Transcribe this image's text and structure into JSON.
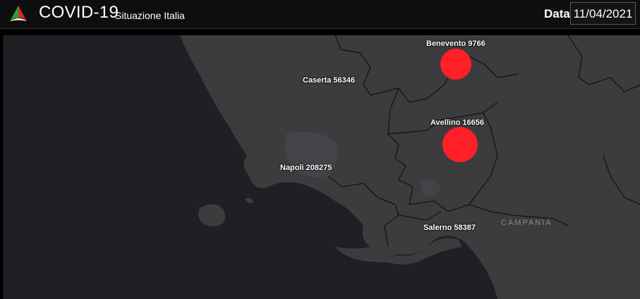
{
  "header": {
    "logo_icon": "italy-flag-cone-icon",
    "title": "COVID-19",
    "subtitle": "Situazione Italia",
    "date_label": "Data",
    "date_value": "11/04/2021"
  },
  "map": {
    "region_label": "CAMPANIA",
    "bubble_color": "#ff1f26",
    "provinces": [
      {
        "name": "Benevento",
        "cases": 9766,
        "label": "Benevento 9766"
      },
      {
        "name": "Caserta",
        "cases": 56346,
        "label": "Caserta 56346"
      },
      {
        "name": "Avellino",
        "cases": 16656,
        "label": "Avellino 16656"
      },
      {
        "name": "Napoli",
        "cases": 208275,
        "label": "Napoli 208275"
      },
      {
        "name": "Salerno",
        "cases": 58387,
        "label": "Salerno 58387"
      }
    ]
  }
}
